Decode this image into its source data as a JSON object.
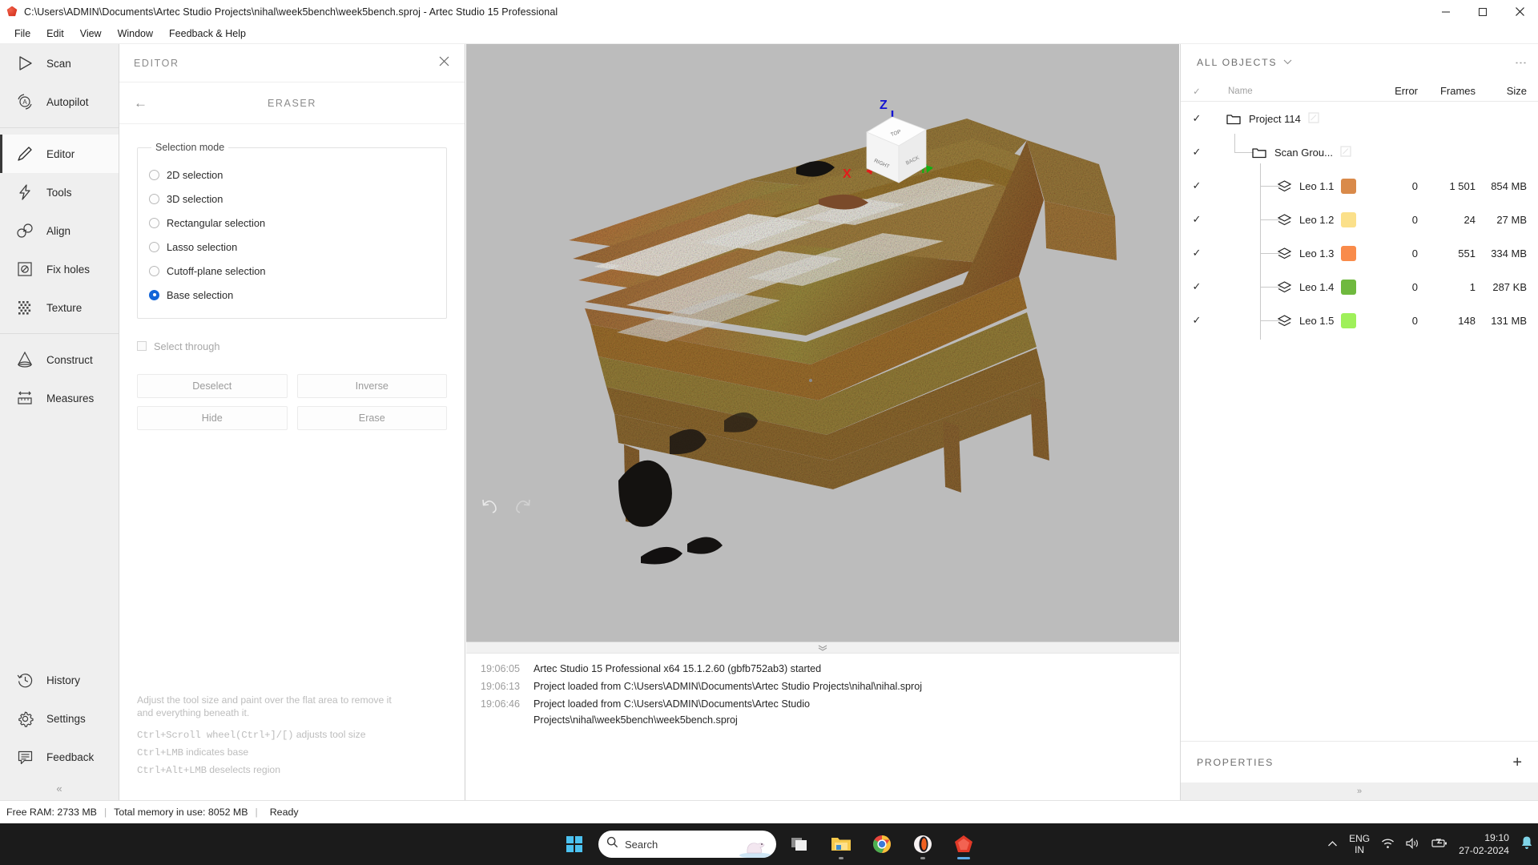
{
  "window": {
    "title": "C:\\Users\\ADMIN\\Documents\\Artec Studio Projects\\nihal\\week5bench\\week5bench.sproj - Artec Studio 15 Professional",
    "minimize_label": "–",
    "maximize_label": "❐",
    "close_label": "✕"
  },
  "menubar": {
    "items": [
      {
        "label": "File"
      },
      {
        "label": "Edit"
      },
      {
        "label": "View"
      },
      {
        "label": "Window"
      },
      {
        "label": "Feedback & Help"
      }
    ]
  },
  "sidebar": {
    "items": [
      {
        "label": "Scan",
        "icon": "play-triangle-icon",
        "active": false
      },
      {
        "label": "Autopilot",
        "icon": "autopilot-icon",
        "active": false
      },
      {
        "label": "Editor",
        "icon": "pencil-icon",
        "active": true
      },
      {
        "label": "Tools",
        "icon": "lightning-icon",
        "active": false
      },
      {
        "label": "Align",
        "icon": "align-icon",
        "active": false
      },
      {
        "label": "Fix holes",
        "icon": "fix-holes-icon",
        "active": false
      },
      {
        "label": "Texture",
        "icon": "texture-grid-icon",
        "active": false
      },
      {
        "label": "Construct",
        "icon": "cone-icon",
        "active": false
      },
      {
        "label": "Measures",
        "icon": "ruler-icon",
        "active": false
      }
    ],
    "bottom_items": [
      {
        "label": "History",
        "icon": "clock-icon"
      },
      {
        "label": "Settings",
        "icon": "gear-icon"
      },
      {
        "label": "Feedback",
        "icon": "chat-icon"
      }
    ],
    "collapse_label": "«"
  },
  "editor": {
    "panel_title": "EDITOR",
    "close_label": "✕",
    "back_label": "←",
    "tool_title": "ERASER",
    "group_legend": "Selection mode",
    "modes": [
      {
        "label": "2D selection",
        "checked": false
      },
      {
        "label": "3D selection",
        "checked": false
      },
      {
        "label": "Rectangular selection",
        "checked": false
      },
      {
        "label": "Lasso selection",
        "checked": false
      },
      {
        "label": "Cutoff-plane selection",
        "checked": false
      },
      {
        "label": "Base selection",
        "checked": true
      }
    ],
    "select_through": {
      "label": "Select through",
      "checked": false
    },
    "buttons": [
      {
        "label": "Deselect"
      },
      {
        "label": "Inverse"
      },
      {
        "label": "Hide"
      },
      {
        "label": "Erase"
      }
    ],
    "hint_paragraph": "Adjust the tool size and paint over the flat area to remove it and everything beneath it.",
    "hints": [
      {
        "key": "Ctrl+Scroll wheel(Ctrl+]/[)",
        "text": " adjusts tool size"
      },
      {
        "key": "Ctrl+LMB",
        "text": " indicates base"
      },
      {
        "key": "Ctrl+Alt+LMB",
        "text": " deselects region"
      }
    ]
  },
  "viewport": {
    "axes": {
      "x": "X",
      "y": "Y",
      "z": "Z"
    },
    "cube_faces": {
      "top": "TOP",
      "front": "RIGHT",
      "right": "BACK"
    },
    "axis_colors": {
      "x": "#e21b1b",
      "y": "#12b012",
      "z": "#1414d2"
    },
    "background_color": "#bcbcbc",
    "undo_label": "undo-icon",
    "redo_label": "redo-icon",
    "fit_label": "fit-to-view-icon",
    "rotate_label": "rotate-icon",
    "box_label": "bounding-box-icon"
  },
  "console": {
    "grip_label": "»",
    "entries": [
      {
        "time": "19:06:05",
        "message": "Artec Studio 15 Professional x64 15.1.2.60 (gbfb752ab3) started"
      },
      {
        "time": "19:06:13",
        "message": "Project loaded from C:\\Users\\ADMIN\\Documents\\Artec Studio Projects\\nihal\\nihal.sproj"
      },
      {
        "time": "19:06:46",
        "message": "Project loaded from C:\\Users\\ADMIN\\Documents\\Artec Studio Projects\\nihal\\week5bench\\week5bench.sproj"
      }
    ]
  },
  "objects_panel": {
    "title": "ALL OBJECTS",
    "chevron": "⌄",
    "kebab": "⋮",
    "columns": {
      "check": "✓",
      "name": "Name",
      "error": "Error",
      "frames": "Frames",
      "size": "Size"
    },
    "rows": [
      {
        "checked": true,
        "depth": 0,
        "icon": "folder-icon",
        "name": "Project 114",
        "editable": true,
        "swatch": null,
        "error": "",
        "frames": "",
        "size": ""
      },
      {
        "checked": true,
        "depth": 1,
        "icon": "folder-icon",
        "name": "Scan Grou...",
        "editable": true,
        "swatch": null,
        "error": "",
        "frames": "",
        "size": ""
      },
      {
        "checked": true,
        "depth": 2,
        "icon": "scan-layers-icon",
        "name": "Leo 1.1",
        "editable": false,
        "swatch": "#d98a4a",
        "error": "0",
        "frames": "1 501",
        "size": "854 MB"
      },
      {
        "checked": true,
        "depth": 2,
        "icon": "scan-layers-icon",
        "name": "Leo 1.2",
        "editable": false,
        "swatch": "#fbe08a",
        "error": "0",
        "frames": "24",
        "size": "27 MB"
      },
      {
        "checked": true,
        "depth": 2,
        "icon": "scan-layers-icon",
        "name": "Leo 1.3",
        "editable": false,
        "swatch": "#f98b4a",
        "error": "0",
        "frames": "551",
        "size": "334 MB"
      },
      {
        "checked": true,
        "depth": 2,
        "icon": "scan-layers-icon",
        "name": "Leo 1.4",
        "editable": false,
        "swatch": "#6fb93e",
        "error": "0",
        "frames": "1",
        "size": "287 KB"
      },
      {
        "checked": true,
        "depth": 2,
        "icon": "scan-layers-icon",
        "name": "Leo 1.5",
        "editable": false,
        "swatch": "#9ff05a",
        "error": "0",
        "frames": "148",
        "size": "131 MB"
      }
    ],
    "properties_title": "PROPERTIES",
    "properties_add": "+",
    "expand_label": "»"
  },
  "statusbar": {
    "free_ram": "Free RAM: 2733 MB",
    "total_memory": "Total memory in use: 8052 MB",
    "state": "Ready",
    "separator": "|"
  },
  "taskbar": {
    "start_label": "start-icon",
    "search_placeholder": "Search",
    "apps": [
      {
        "name": "task-view-icon",
        "running": false
      },
      {
        "name": "file-explorer-icon",
        "running": true
      },
      {
        "name": "chrome-icon",
        "running": false
      },
      {
        "name": "opera-icon",
        "running": true
      },
      {
        "name": "artec-studio-icon",
        "running": true,
        "active": true
      }
    ],
    "tray": {
      "chevron": "∧",
      "language_line1": "ENG",
      "language_line2": "IN",
      "wifi": "wifi-icon",
      "volume": "volume-icon",
      "battery": "battery-icon",
      "time": "19:10",
      "date": "27-02-2024",
      "bell": "notification-bell-icon"
    }
  }
}
